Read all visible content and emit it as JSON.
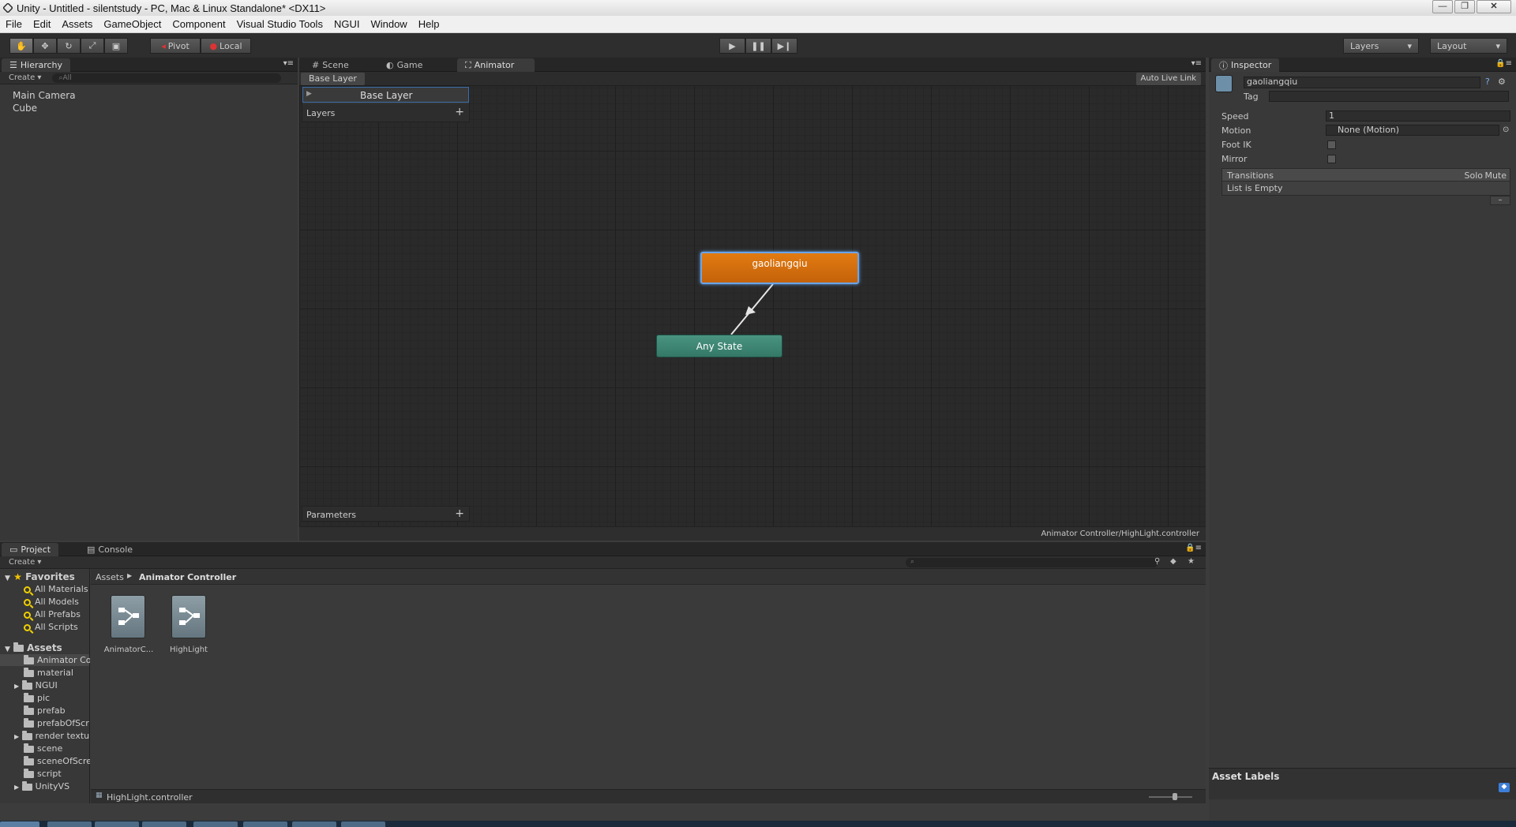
{
  "window": {
    "title": "Unity - Untitled - silentstudy - PC, Mac & Linux Standalone* <DX11>",
    "minimize": "—",
    "maximize": "❐",
    "close": "✕"
  },
  "menu": [
    "File",
    "Edit",
    "Assets",
    "GameObject",
    "Component",
    "Visual Studio Tools",
    "NGUI",
    "Window",
    "Help"
  ],
  "toolbar": {
    "pivot": "Pivot",
    "local": "Local",
    "layers": "Layers",
    "layout": "Layout"
  },
  "hierarchy": {
    "tab": "Hierarchy",
    "create": "Create",
    "search_placeholder": "All",
    "items": [
      "Main Camera",
      "Cube"
    ]
  },
  "center": {
    "tabs": [
      "Scene",
      "Game",
      "Animator"
    ],
    "active_tab": "Animator",
    "breadcrumb": "Base Layer",
    "auto_live_link": "Auto Live Link",
    "layer_item": "Base Layer",
    "layers_label": "Layers",
    "parameters_label": "Parameters",
    "add_symbol": "+",
    "status_path": "Animator Controller/HighLight.controller",
    "states": {
      "default_state": "gaoliangqiu",
      "any_state": "Any State"
    }
  },
  "inspector": {
    "tab": "Inspector",
    "object_name": "gaoliangqiu",
    "tag_label": "Tag",
    "speed_label": "Speed",
    "speed_value": "1",
    "motion_label": "Motion",
    "motion_value": "None (Motion)",
    "foot_ik_label": "Foot IK",
    "mirror_label": "Mirror",
    "transitions_label": "Transitions",
    "solo_label": "Solo",
    "mute_label": "Mute",
    "list_empty": "List is Empty",
    "remove_symbol": "–",
    "asset_labels": "Asset Labels"
  },
  "project": {
    "tabs": [
      "Project",
      "Console"
    ],
    "create": "Create",
    "favorites_label": "Favorites",
    "favorites": [
      "All Materials",
      "All Models",
      "All Prefabs",
      "All Scripts"
    ],
    "assets_label": "Assets",
    "folders": [
      "Animator Co",
      "material",
      "NGUI",
      "pic",
      "prefab",
      "prefabOfScr",
      "render textu",
      "scene",
      "sceneOfScre",
      "script",
      "UnityVS"
    ],
    "breadcrumb_root": "Assets",
    "breadcrumb_current": "Animator Controller",
    "assets": [
      "AnimatorC...",
      "HighLight"
    ],
    "selected_file": "HighLight.controller"
  },
  "colors": {
    "default_state": "#d8700c",
    "any_state": "#3d8574",
    "selection_blue": "#3c6ea8"
  }
}
